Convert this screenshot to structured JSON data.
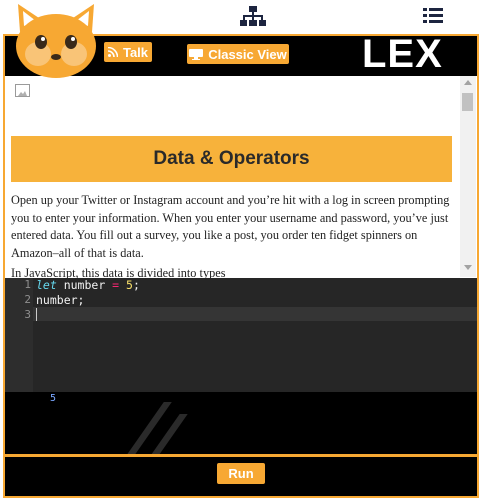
{
  "header": {
    "talk_label": "Talk",
    "classic_view_label": "Classic View",
    "logo_text": "LEX"
  },
  "lesson": {
    "title": "Data & Operators",
    "paragraph": "Open up your Twitter or Instagram account and you’re hit with a log in screen prompting you to enter your information. When you enter your username and password, you’ve just entered data. You fill out a survey, you like a post, you order ten fidget spinners on Amazon–all of that is data.",
    "cut_line": "In JavaScript, this data is divided into types"
  },
  "editor": {
    "line_numbers": [
      "1",
      "2",
      "3"
    ],
    "line1": {
      "keyword": "let",
      "ident": " number ",
      "op": "=",
      "space": " ",
      "num": "5",
      "end": ";"
    },
    "line2": "number;",
    "line3": ""
  },
  "console": {
    "output": "5"
  },
  "footer": {
    "run_label": "Run"
  },
  "icons": {
    "mascot": "fox-mascot-icon",
    "top_center": "hierarchy-icon",
    "top_right": "list-icon",
    "talk": "rss-icon",
    "classic_view": "monitor-icon",
    "lesson_image": "broken-image-icon"
  },
  "colors": {
    "accent": "#f7a833",
    "banner": "#f7b23b",
    "editor_bg": "#262626",
    "console_text": "#7aa7ff"
  }
}
